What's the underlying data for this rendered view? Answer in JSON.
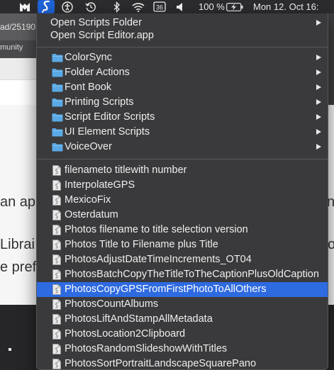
{
  "menubar": {
    "items": [
      {
        "name": "cat-app-icon",
        "glyph": "M"
      },
      {
        "name": "scripts-menu-icon",
        "glyph": "§"
      },
      {
        "name": "accessibility-icon",
        "glyph": "♿"
      },
      {
        "name": "time-machine-icon",
        "glyph": "⟲"
      },
      {
        "name": "bluetooth-icon",
        "glyph": "ᛒ"
      },
      {
        "name": "wifi-icon",
        "glyph": ""
      },
      {
        "name": "calendar-badge-icon",
        "glyph": "36"
      },
      {
        "name": "volume-icon",
        "glyph": "◀"
      }
    ],
    "battery_percent": "100 %",
    "clock": "Mon 12. Oct  16:"
  },
  "background": {
    "url_fragment": "ad/25190",
    "tab_fragment": "munity",
    "text_line_1": "an ap",
    "text_line_2": "Librai",
    "text_line_3": "e pref",
    "text_right_1": "no",
    "text_right_2": "o"
  },
  "menu": {
    "top_items": [
      {
        "label": "Open Scripts Folder",
        "submenu": true
      },
      {
        "label": "Open Script Editor.app",
        "submenu": false
      }
    ],
    "folders": [
      {
        "label": "ColorSync"
      },
      {
        "label": "Folder Actions"
      },
      {
        "label": "Font Book"
      },
      {
        "label": "Printing Scripts"
      },
      {
        "label": "Script Editor Scripts"
      },
      {
        "label": "UI Element Scripts"
      },
      {
        "label": "VoiceOver"
      }
    ],
    "scripts": [
      {
        "label": "filenameto titlewith number"
      },
      {
        "label": "InterpolateGPS"
      },
      {
        "label": "MexicoFix"
      },
      {
        "label": "Osterdatum"
      },
      {
        "label": "Photos filename to title selection version"
      },
      {
        "label": "Photos Title to Filename plus Title"
      },
      {
        "label": "PhotosAdjustDateTimeIncrements_OT04"
      },
      {
        "label": "PhotosBatchCopyTheTitleToTheCaptionPlusOldCaption"
      },
      {
        "label": "PhotosCopyGPSFromFirstPhotoToAllOthers",
        "highlighted": true
      },
      {
        "label": "PhotosCountAlbums"
      },
      {
        "label": "PhotosLiftAndStampAllMetadata"
      },
      {
        "label": "PhotosLocation2Clipboard"
      },
      {
        "label": "PhotosRandomSlideshowWithTitles"
      },
      {
        "label": "PhotosSortPortraitLandscapeSquarePano"
      }
    ]
  },
  "colors": {
    "menu_bg": "#3a3a3c",
    "highlight": "#2e6ae0",
    "folder_icon": "#5aa9e6",
    "menubar_bg": "#2c2c2e"
  }
}
